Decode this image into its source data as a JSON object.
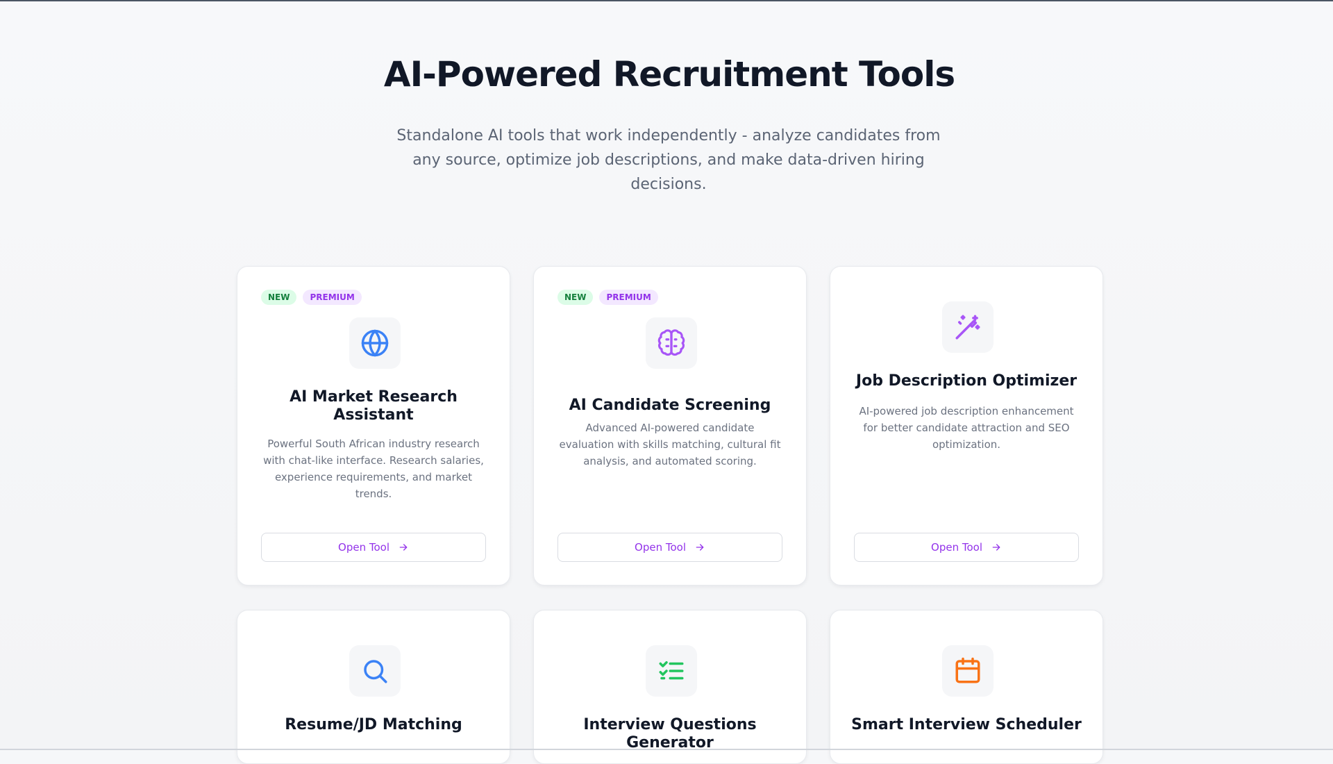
{
  "header": {
    "title": "AI-Powered Recruitment Tools",
    "subtitle": "Standalone AI tools that work independently - analyze candidates from any source, optimize job descriptions, and make data-driven hiring decisions."
  },
  "badges": {
    "new": "NEW",
    "premium": "PREMIUM"
  },
  "cards": [
    {
      "title": "AI Market Research Assistant",
      "description": "Powerful South African industry research with chat-like interface. Research salaries, experience requirements, and market trends.",
      "button": "Open Tool",
      "icon": "globe-icon",
      "icon_color": "#3b82f6"
    },
    {
      "title": "AI Candidate Screening",
      "description": "Advanced AI-powered candidate evaluation with skills matching, cultural fit analysis, and automated scoring.",
      "button": "Open Tool",
      "icon": "brain-icon",
      "icon_color": "#a855f7"
    },
    {
      "title": "Job Description Optimizer",
      "description": "AI-powered job description enhancement for better candidate attraction and SEO optimization.",
      "button": "Open Tool",
      "icon": "magic-wand-icon",
      "icon_color": "#a855f7"
    },
    {
      "title": "Resume/JD Matching",
      "icon": "search-icon",
      "icon_color": "#3b82f6"
    },
    {
      "title": "Interview Questions Generator",
      "icon": "checklist-icon",
      "icon_color": "#22c55e"
    },
    {
      "title": "Smart Interview Scheduler",
      "icon": "calendar-icon",
      "icon_color": "#f97316"
    }
  ]
}
